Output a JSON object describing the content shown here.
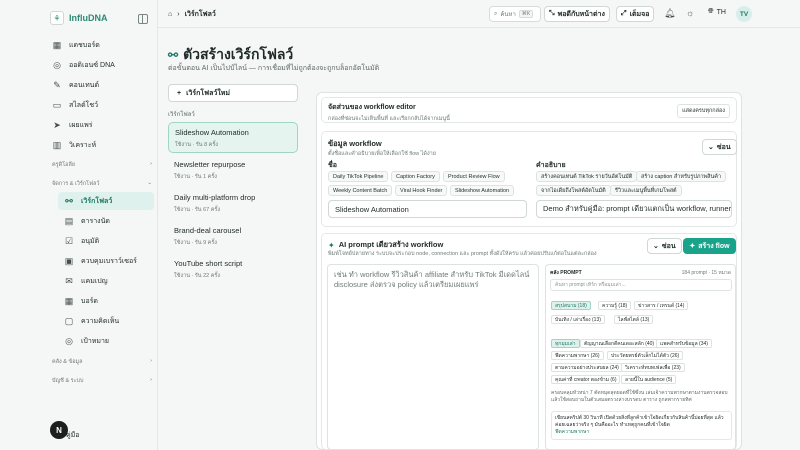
{
  "brand": {
    "name": "InfluDNA",
    "mark": "IN"
  },
  "nav": {
    "top": [
      {
        "label": "แดชบอร์ด",
        "icon": "grid"
      },
      {
        "label": "ออดิเอนซ์ DNA",
        "icon": "dna"
      },
      {
        "label": "คอนเทนต์",
        "icon": "content"
      },
      {
        "label": "สไลด์โชว์",
        "icon": "slides"
      },
      {
        "label": "เผยแพร่",
        "icon": "send"
      },
      {
        "label": "วิเคราะห์",
        "icon": "chart"
      }
    ],
    "section_lab": "ครูดิโอลีย",
    "section_automation": "จัดการ & เวิร์กโฟลว์",
    "automation": [
      {
        "label": "เวิร์กโฟลว์",
        "icon": "flow",
        "active": true
      },
      {
        "label": "ตารางนัด",
        "icon": "calendar"
      },
      {
        "label": "อนุมัติ",
        "icon": "approve"
      },
      {
        "label": "ควบคุมเบราว์เซอร์",
        "icon": "browser"
      },
      {
        "label": "แคมเปญ",
        "icon": "mail"
      },
      {
        "label": "บอร์ด",
        "icon": "board"
      },
      {
        "label": "ความคิดเห็น",
        "icon": "comment"
      },
      {
        "label": "เป้าหมาย",
        "icon": "target"
      }
    ],
    "section_data": "คลัง & ข้อมูล",
    "section_account": "บัญชี & ระบบ",
    "help": "คู่มือ",
    "avatar": "N"
  },
  "topbar": {
    "breadcrumb": "เวิร์กโฟลว์",
    "search_placeholder": "ค้นหา",
    "search_kbd": "⌘K",
    "back_btn": "พอดีกับหน้าต่าง",
    "full_btn": "เต็มจอ",
    "lang": "TH",
    "user_initials": "TV"
  },
  "page": {
    "title": "ตัวสร้างเวิร์กโฟลว์",
    "subtitle": "ต่อขั้นตอน AI เป็นไปป์ไลน์ — การเชื่อมที่ไม่ถูกต้องจะถูกบล็อกอัตโนมัติ"
  },
  "list": {
    "new_button": "เวิร์กโฟลว์ใหม่",
    "header": "เวิร์กโฟลว์",
    "items": [
      {
        "name": "Slideshow Automation",
        "meta": "ใช้งาน · รัน 8 ครั้ง"
      },
      {
        "name": "Newsletter repurpose",
        "meta": "ใช้งาน · รัน 1 ครั้ง"
      },
      {
        "name": "Daily multi-platform drop",
        "meta": "ใช้งาน · รัน 67 ครั้ง"
      },
      {
        "name": "Brand-deal carousel",
        "meta": "ใช้งาน · รัน 9 ครั้ง"
      },
      {
        "name": "YouTube short script",
        "meta": "ใช้งาน · รัน 22 ครั้ง"
      }
    ]
  },
  "editor": {
    "title": "จัดส่วนของ workflow editor",
    "subtitle": "กล่องที่ซ่อนจะไม่เห็นพื้นที่ และเรียกกลับได้จากเมนูนี้",
    "open_all": "แสดงครบทุกกล่อง",
    "info": {
      "title": "ข้อมูล workflow",
      "subtitle": "ตั้งชื่อและคำอธิบายเพื่อให้เลือกใช้ flow ได้ง่าย",
      "hide": "ซ่อน",
      "name_label": "ชื่อ",
      "desc_label": "คำอธิบาย",
      "name_chips": [
        "Daily TikTok Pipeline",
        "Caption Factory",
        "Product Review Flow",
        "Weekly Content Batch",
        "Viral Hook Finder",
        "Slideshow Automation"
      ],
      "desc_chips": [
        "สร้างคอนเทนต์ TikTok รายวันอัตโนมัติ",
        "สร้าง caption สำหรับรูปภาพสินค้า",
        "จากไอเดียถึงโพสต์อัตโนมัติ",
        "รีวิวและเมนูพื้นที่เกมโพสต์"
      ],
      "name_value": "Slideshow Automation",
      "desc_value": "Demo สำหรับคู่มือ: prompt เดียวแตกเป็น workflow, runner สร้"
    },
    "ai": {
      "title": "AI prompt เดียวสร้าง workflow",
      "subtitle": "พิมพ์โจทย์ปลายทาง ระบบจะประกอบ node, connection และ prompt ทั้งดังให้ครบ แล้วค่อยปรับแก้ต่อในแต่ละกล่อง",
      "hide": "ซ่อน",
      "create": "สร้าง flow",
      "prompt_text": "เช่น ทำ workflow รีวิวสินค้า affiliate สำหรับ TikTok มีเดดไลน์ disclosure ส่งตรวจ policy แล้วเตรียมเผยแพร่",
      "library": {
        "header": "คลัง PROMPT",
        "count": "184 prompt · 15 หมวด",
        "search": "ค้นหา prompt เทิร์ก หรือมุมเล่า...",
        "cats": [
          "สรุปสนาม (18)",
          "ความรู้ (18)",
          "ข่าวสาร / เทรนด์ (14)",
          "บันเทิง / เล่าเรื่อง (13)",
          "ไลฟ์สไตล์ (13)"
        ],
        "tags": [
          "ทุกมุมเล่า",
          "ตัญญาณเลือกดีคนเดอะสลัก (40)",
          "แพคสำหรับข้อมูล (34)",
          "ฟีดความพากษา (26)",
          "ประวัตยพรย์ตัวเล็กไม่ได้ตัว (26)",
          "ตามความอย่างประสบผล (24)",
          "วิเคราะห์ทบทเฟลเพื่อ (23)",
          "คุณค่าที่ creator ตองข้าม (6)",
          "ลายนี้ใน audience (5)"
        ],
        "note": "ครอบคลุมหัวหน่า 7 ตัดหมุดสุดยอดที่ใช้ซึ่งน เล่มเจ้าความพากษาตามงานตรวจสอบ แล้วใช้สอบถามในตัวเสมอตรวงล่างบรรดบ ตาราง ถูกลพากรายทิศ",
        "card_text": "เขียนสคริปต์ 30 วินาที เปิดด้วยสิ่งที่ลูกค้าเข้าใจผิดเกี่ยวกับสินค้านี้บ่อยที่สุด แล้วค่อยเฉลยว่าจริง ๆ มันคืออะไร ทำเหตุถูกคนที่เข้าใจผิด",
        "card_link": "ฟีดความพากษา"
      }
    }
  }
}
